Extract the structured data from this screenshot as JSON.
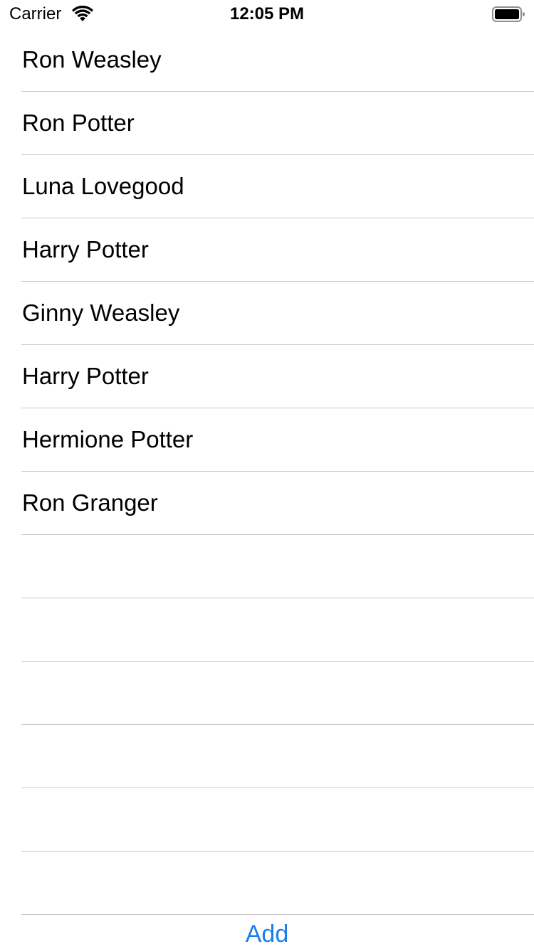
{
  "status_bar": {
    "carrier": "Carrier",
    "time": "12:05 PM",
    "wifi_icon": "wifi-icon",
    "battery_icon": "battery-icon"
  },
  "table": {
    "rows": [
      {
        "label": "Ron Weasley"
      },
      {
        "label": "Ron Potter"
      },
      {
        "label": "Luna Lovegood"
      },
      {
        "label": "Harry Potter"
      },
      {
        "label": "Ginny Weasley"
      },
      {
        "label": "Harry Potter"
      },
      {
        "label": "Hermione Potter"
      },
      {
        "label": "Ron Granger"
      },
      {
        "label": ""
      },
      {
        "label": ""
      },
      {
        "label": ""
      },
      {
        "label": ""
      },
      {
        "label": ""
      },
      {
        "label": ""
      }
    ]
  },
  "toolbar": {
    "add_label": "Add"
  },
  "colors": {
    "accent": "#1a7fe8",
    "separator": "#c8c7cc"
  }
}
